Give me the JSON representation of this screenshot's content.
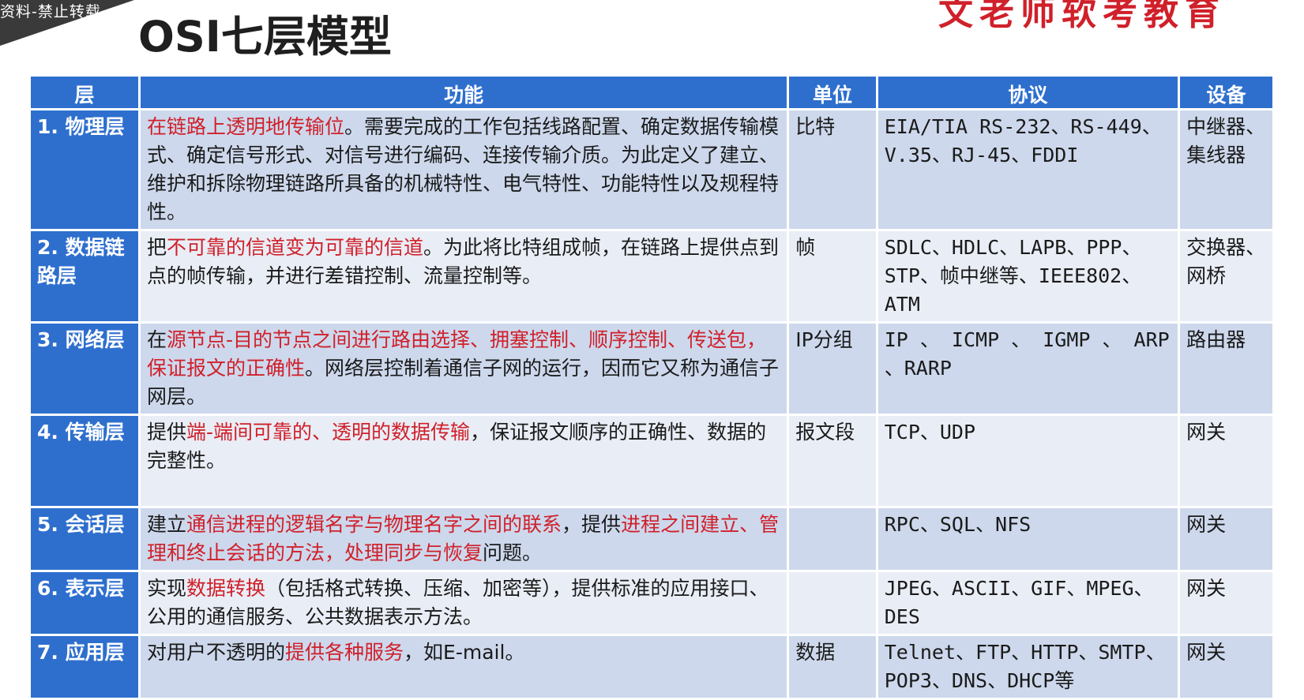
{
  "watermark": "资料-禁止转载",
  "title": "OSI七层模型",
  "brand": "文老师软考教育",
  "table": {
    "headers": [
      "层",
      "功能",
      "单位",
      "协议",
      "设备"
    ],
    "rows": [
      {
        "layer": "1. 物理层",
        "func_red": "在链路上透明地传输位",
        "func_rest": "。需要完成的工作包括线路配置、确定数据传输模式、确定信号形式、对信号进行编码、连接传输介质。为此定义了建立、维护和拆除物理链路所具备的机械特性、电气特性、功能特性以及规程特性。",
        "unit": "比特",
        "protocol": "EIA/TIA RS-232、RS-449、V.35、RJ-45、FDDI",
        "device": "中继器、集线器"
      },
      {
        "layer": "2. 数据链路层",
        "func_pre": "把",
        "func_red": "不可靠的信道变为可靠的信道",
        "func_rest": "。为此将比特组成帧，在链路上提供点到点的帧传输，并进行差错控制、流量控制等。",
        "unit": "帧",
        "protocol": "SDLC、HDLC、LAPB、PPP、STP、帧中继等、IEEE802、ATM",
        "device": "交换器、网桥"
      },
      {
        "layer": "3. 网络层",
        "func_pre": "在",
        "func_red": "源节点-目的节点之间进行路由选择、拥塞控制、顺序控制、传送包，保证报文的正确性",
        "func_rest": "。网络层控制着通信子网的运行，因而它又称为通信子网层。",
        "unit": "IP分组",
        "protocol": "IP 、 ICMP 、 IGMP 、 ARP 、RARP",
        "device": "路由器"
      },
      {
        "layer": "4. 传输层",
        "func_pre": "提供",
        "func_red": "端-端间可靠的、透明的数据传输",
        "func_rest": "，保证报文顺序的正确性、数据的完整性。",
        "unit": "报文段",
        "protocol": "TCP、UDP",
        "device": "网关"
      },
      {
        "layer": "5. 会话层",
        "func_pre": "建立",
        "func_red": "通信进程的逻辑名字与物理名字之间的联系",
        "func_mid": "，提供",
        "func_red2": "进程之间建立、管理和终止会话的方法，处理同步与恢复",
        "func_rest": "问题。",
        "unit": "",
        "protocol": "RPC、SQL、NFS",
        "device": "网关"
      },
      {
        "layer": "6. 表示层",
        "func_pre": "实现",
        "func_red": "数据转换",
        "func_rest": "（包括格式转换、压缩、加密等），提供标准的应用接口、公用的通信服务、公共数据表示方法。",
        "unit": "",
        "protocol": "JPEG、ASCII、GIF、MPEG、DES",
        "device": "网关"
      },
      {
        "layer": "7. 应用层",
        "func_pre": "对用户不透明的",
        "func_red": "提供各种服务",
        "func_rest": "，如E-mail。",
        "unit": "数据",
        "protocol": "Telnet、FTP、HTTP、SMTP、POP3、DNS、DHCP等",
        "device": "网关"
      }
    ]
  },
  "colors": {
    "header_blue": "#2e6fce",
    "row_odd": "#cdd8ec",
    "row_even": "#e9edf5",
    "highlight_red": "#d0202a"
  }
}
